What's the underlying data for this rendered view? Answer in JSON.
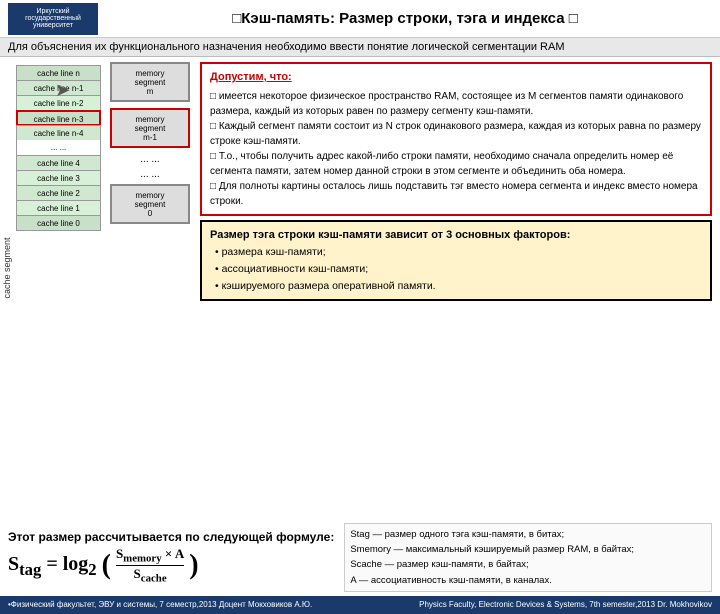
{
  "header": {
    "logo_line1": "Иркутский",
    "logo_line2": "государственный",
    "logo_line3": "университет",
    "title": "□Кэш-память: Размер строки, тэга и индекса □"
  },
  "subtitle": {
    "text": "Для объяснения их функционального назначения необходимо ввести понятие логической сегментации RAM"
  },
  "cache_lines": {
    "label": "cache segment",
    "items": [
      "cache line n",
      "cache line n-1",
      "cache line n-2",
      "cache line n-3",
      "cache line n-4",
      "... ...",
      "cache line 4",
      "cache line 3",
      "cache line 2",
      "cache line 1",
      "cache line 0"
    ]
  },
  "memory_segments": {
    "items": [
      "memory segment m",
      "memory segment m-1",
      "... ...",
      "... ...",
      "memory segment 0"
    ],
    "dots1": "... ...",
    "dots2": "... ..."
  },
  "dopustim": {
    "title": "Допустим, что:",
    "items": [
      "имеется некоторое физическое пространство RAM, состоящее из M сегментов памяти одинакового размера, каждый из которых равен по размеру сегменту кэш-памяти.",
      "Каждый сегмент памяти состоит из N строк одинакового размера, каждая из которых равна по размеру строке кэш-памяти.",
      "Т.о., чтобы получить адрес какой-либо строки памяти, необходимо сначала определить номер её сегмента памяти, затем номер данной строки в этом сегменте и объединить оба номера.",
      "Для полноты картины осталось лишь подставить тэг вместо номера сегмента и индекс вместо номера строки."
    ]
  },
  "razmer": {
    "title": "Размер тэга строки кэш-памяти зависит от 3 основных факторов:",
    "items": [
      "размера кэш-памяти;",
      "ассоциативности кэш-памяти;",
      "кэшируемого размера оперативной памяти."
    ]
  },
  "formula": {
    "intro": "Этот размер рассчитывается по следующей формуле:",
    "math": "S_tag = log₂( S_memory × A / S_cache )",
    "desc_items": [
      "Stag — размер одного тэга кэш-памяти, в битах;",
      "Smemory — максимальный кэшируемый размер RAM, в байтах;",
      "Scache — размер кэш-памяти, в байтах;",
      "A — ассоциативность кэш-памяти, в каналах."
    ]
  },
  "footer": {
    "left": "•Физический факультет, ЭВУ и системы, 7 семестр,2013 Доцент Мокховиков А.Ю.",
    "right": "Physics Faculty, Electronic Devices & Systems, 7th semester,2013  Dr. Mokhovikov"
  }
}
